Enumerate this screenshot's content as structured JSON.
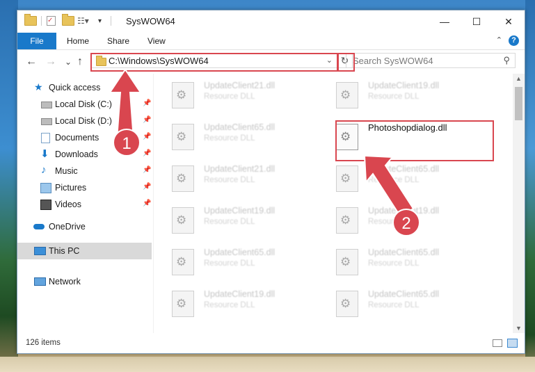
{
  "window": {
    "title": "SysWOW64",
    "minimize": "—",
    "maximize": "☐",
    "close": "✕"
  },
  "ribbon": {
    "tabs": [
      "File",
      "Home",
      "Share",
      "View"
    ],
    "help": "?",
    "collapse": "⌃"
  },
  "nav": {
    "back": "←",
    "forward": "→",
    "recent": "⌄",
    "up": "↑",
    "address": "C:\\Windows\\SysWOW64",
    "refresh": "↻",
    "search_placeholder": "Search SysWOW64"
  },
  "sidebar": {
    "items": [
      {
        "label": "Quick access",
        "icon": "star-icon",
        "pinned": false
      },
      {
        "label": "Local Disk (C:)",
        "icon": "drive-icon",
        "pinned": true
      },
      {
        "label": "Local Disk (D:)",
        "icon": "drive-icon",
        "pinned": true
      },
      {
        "label": "Documents",
        "icon": "documents-icon",
        "pinned": true
      },
      {
        "label": "Downloads",
        "icon": "download-icon",
        "pinned": true
      },
      {
        "label": "Music",
        "icon": "music-icon",
        "pinned": true
      },
      {
        "label": "Pictures",
        "icon": "pictures-icon",
        "pinned": true
      },
      {
        "label": "Videos",
        "icon": "videos-icon",
        "pinned": true
      },
      {
        "label": "OneDrive",
        "icon": "cloud-icon",
        "pinned": false
      },
      {
        "label": "This PC",
        "icon": "computer-icon",
        "pinned": false
      },
      {
        "label": "Network",
        "icon": "network-icon",
        "pinned": false
      }
    ]
  },
  "files": [
    {
      "name": "UpdateClient21.dll",
      "type": "Resource DLL"
    },
    {
      "name": "UpdateClient19.dll",
      "type": "Resource DLL"
    },
    {
      "name": "UpdateClient65.dll",
      "type": "Resource DLL"
    },
    {
      "name": "Photoshopdialog.dll",
      "type": ""
    },
    {
      "name": "UpdateClient21.dll",
      "type": "Resource DLL"
    },
    {
      "name": "UpdateClient65.dll",
      "type": "Resource DLL"
    },
    {
      "name": "UpdateClient19.dll",
      "type": "Resource DLL"
    },
    {
      "name": "UpdateClient19.dll",
      "type": "Resource DLL"
    },
    {
      "name": "UpdateClient65.dll",
      "type": "Resource DLL"
    },
    {
      "name": "UpdateClient65.dll",
      "type": "Resource DLL"
    },
    {
      "name": "UpdateClient19.dll",
      "type": "Resource DLL"
    },
    {
      "name": "UpdateClient65.dll",
      "type": "Resource DLL"
    }
  ],
  "status": {
    "item_count": "126 items"
  },
  "annotations": {
    "badge1": "1",
    "badge2": "2"
  },
  "colors": {
    "accent": "#1979ca",
    "annotation": "#d9464f",
    "selected": "#d9d9d9"
  }
}
